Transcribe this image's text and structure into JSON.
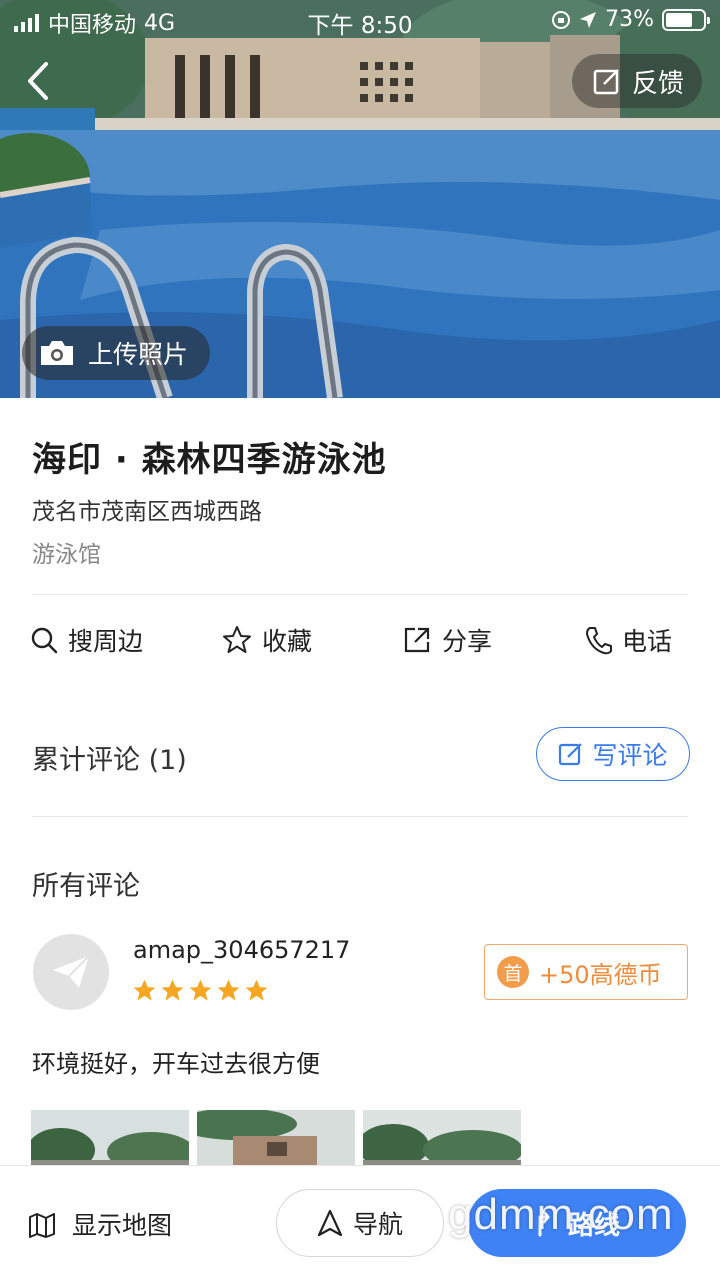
{
  "status_bar": {
    "carrier": "中国移动",
    "network": "4G",
    "time": "下午 8:50",
    "battery": "73%",
    "battery_level": 0.73
  },
  "header": {
    "back_icon": "chevron-left-icon",
    "feedback_label": "反馈",
    "upload_label": "上传照片"
  },
  "poi": {
    "title": "海印 · 森林四季游泳池",
    "address": "茂名市茂南区西城西路",
    "category": "游泳馆"
  },
  "actions": [
    {
      "label": "搜周边",
      "icon": "search-icon"
    },
    {
      "label": "收藏",
      "icon": "star-outline-icon"
    },
    {
      "label": "分享",
      "icon": "share-icon"
    },
    {
      "label": "电话",
      "icon": "phone-icon"
    }
  ],
  "reviews": {
    "header": "累计评论 (1)",
    "write_label": "写评论",
    "all_label": "所有评论",
    "items": [
      {
        "username": "amap_304657217",
        "rating": 5,
        "badge_icon_text": "首",
        "badge_text": "+50高德币",
        "text": "环境挺好，开车过去很方便"
      }
    ]
  },
  "bottom_bar": {
    "show_map_label": "显示地图",
    "navigate_label": "导航",
    "route_label": "路线"
  },
  "watermark": "gdmm.com",
  "colors": {
    "accent": "#3f82f5",
    "star": "#f5a623",
    "coin": "#ee8c3c"
  }
}
